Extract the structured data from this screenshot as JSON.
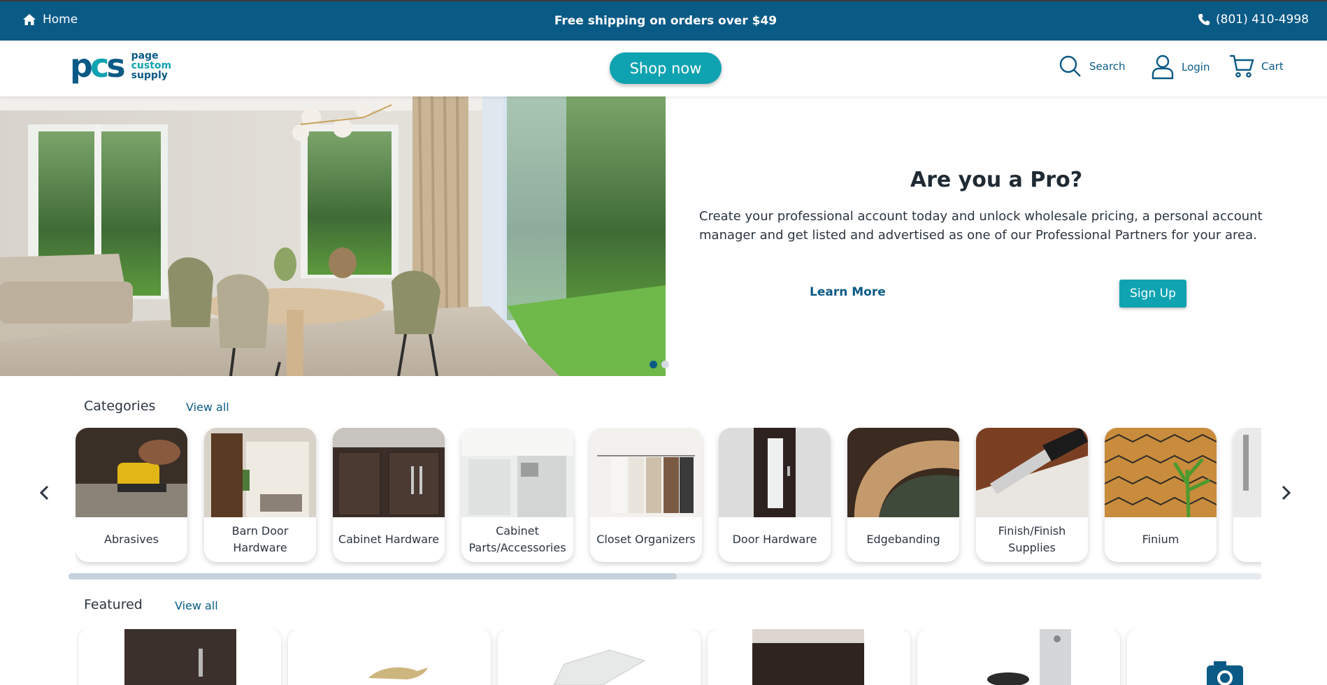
{
  "topbar": {
    "home_label": "Home",
    "promo": "Free shipping on orders over $49",
    "phone": "(801) 410-4998"
  },
  "header": {
    "logo_mark": "pcs",
    "logo_words": [
      "page",
      "custom",
      "supply"
    ],
    "shop_now": "Shop now",
    "search_label": "Search",
    "login_label": "Login",
    "cart_label": "Cart"
  },
  "hero": {
    "title": "Are you a Pro?",
    "description": "Create your professional account today and unlock wholesale pricing, a personal account manager and get listed and advertised as one of our Professional Partners for your area.",
    "learn_more": "Learn More",
    "sign_up": "Sign Up",
    "slides_count": 2,
    "active_slide": 1
  },
  "categories": {
    "title": "Categories",
    "view_all": "View all",
    "items": [
      {
        "label": "Abrasives"
      },
      {
        "label": "Barn Door Hardware"
      },
      {
        "label": "Cabinet Hardware"
      },
      {
        "label": "Cabinet Parts/Accessories"
      },
      {
        "label": "Closet Organizers"
      },
      {
        "label": "Door Hardware"
      },
      {
        "label": "Edgebanding"
      },
      {
        "label": "Finish/Finish Supplies"
      },
      {
        "label": "Finium"
      }
    ],
    "scroll_progress": 0.51
  },
  "featured": {
    "title": "Featured",
    "view_all": "View all"
  },
  "colors": {
    "brand_dark": "#0a5a86",
    "brand_teal": "#0fa3b1"
  },
  "icons": [
    "home-icon",
    "phone-icon",
    "search-icon",
    "user-icon",
    "cart-icon",
    "chevron-left-icon",
    "chevron-right-icon",
    "camera-icon"
  ]
}
